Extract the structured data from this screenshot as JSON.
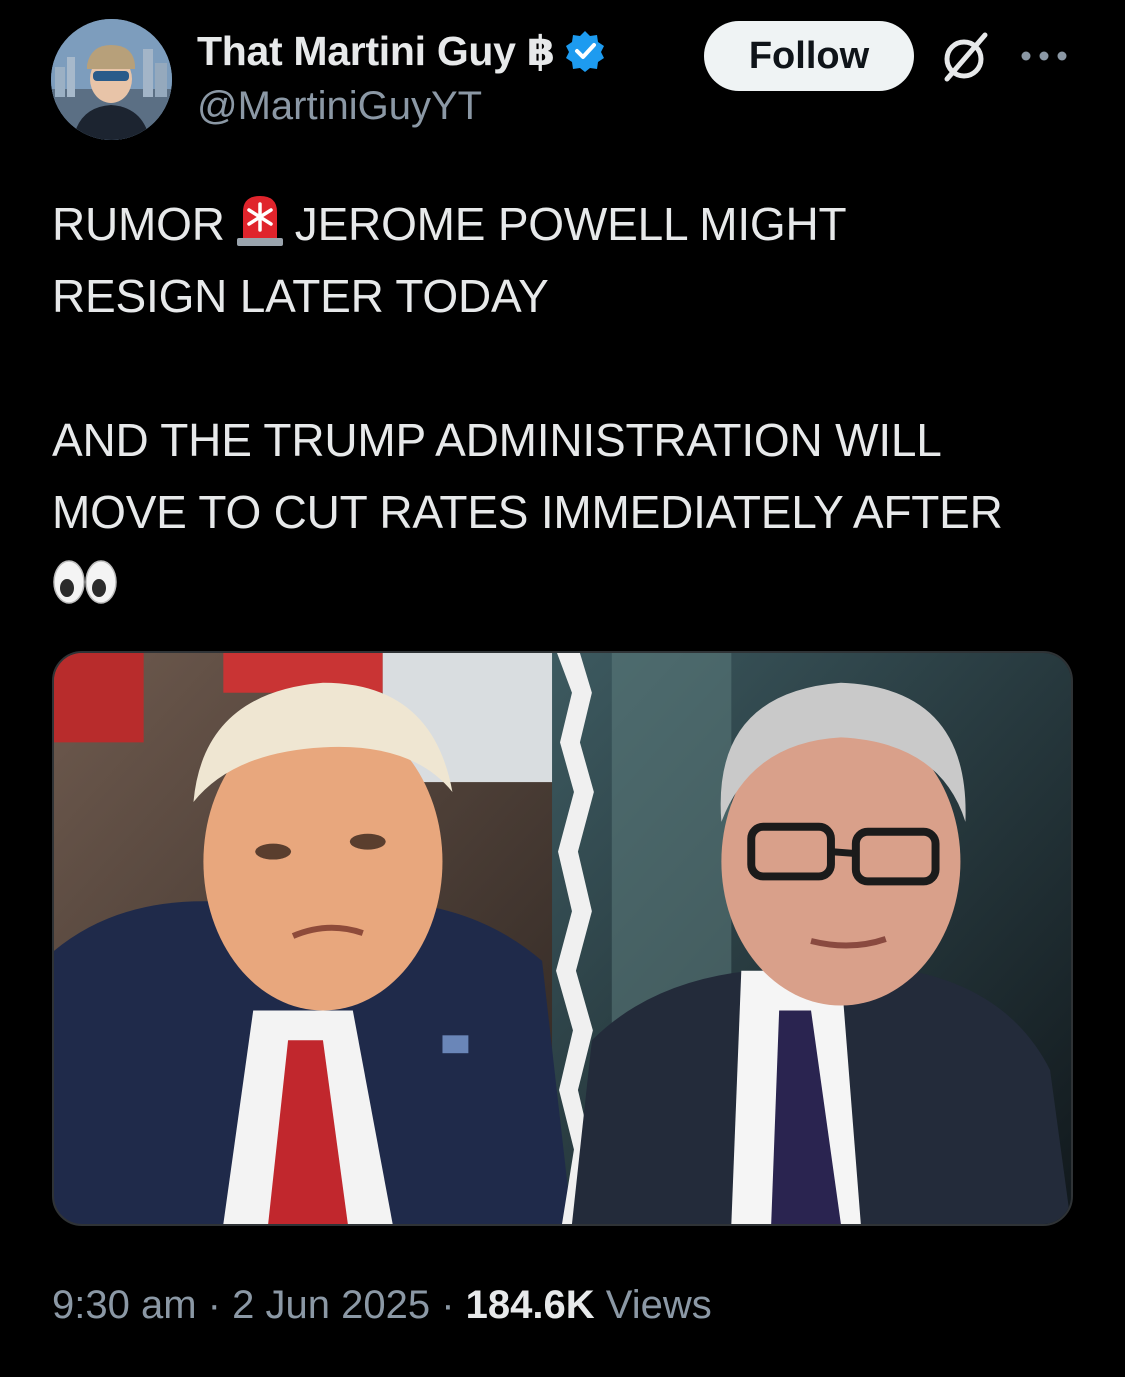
{
  "author": {
    "display_name": "That Martini Guy ฿",
    "handle": "@MartiniGuyYT",
    "verified": true,
    "verified_color": "#1d9bf0"
  },
  "actions": {
    "follow_label": "Follow"
  },
  "tweet": {
    "lines": [
      {
        "before": "RUMOR",
        "emoji": "police-car-light",
        "after": "JEROME POWELL MIGHT"
      },
      {
        "text": "RESIGN LATER TODAY"
      },
      {
        "text": "AND THE TRUMP ADMINISTRATION WILL"
      },
      {
        "text": "MOVE TO CUT RATES IMMEDIATELY AFTER"
      }
    ],
    "trailing_emoji": "eyes"
  },
  "media": {
    "icon": "photo-split-two-portraits"
  },
  "meta": {
    "time": "9:30 am",
    "separator": "·",
    "date": "2 Jun 2025",
    "views_count": "184.6K",
    "views_label": "Views"
  },
  "colors": {
    "background": "#000000",
    "text": "#e7e9ea",
    "secondary": "#8b98a5",
    "follow_bg": "#eff3f4"
  }
}
